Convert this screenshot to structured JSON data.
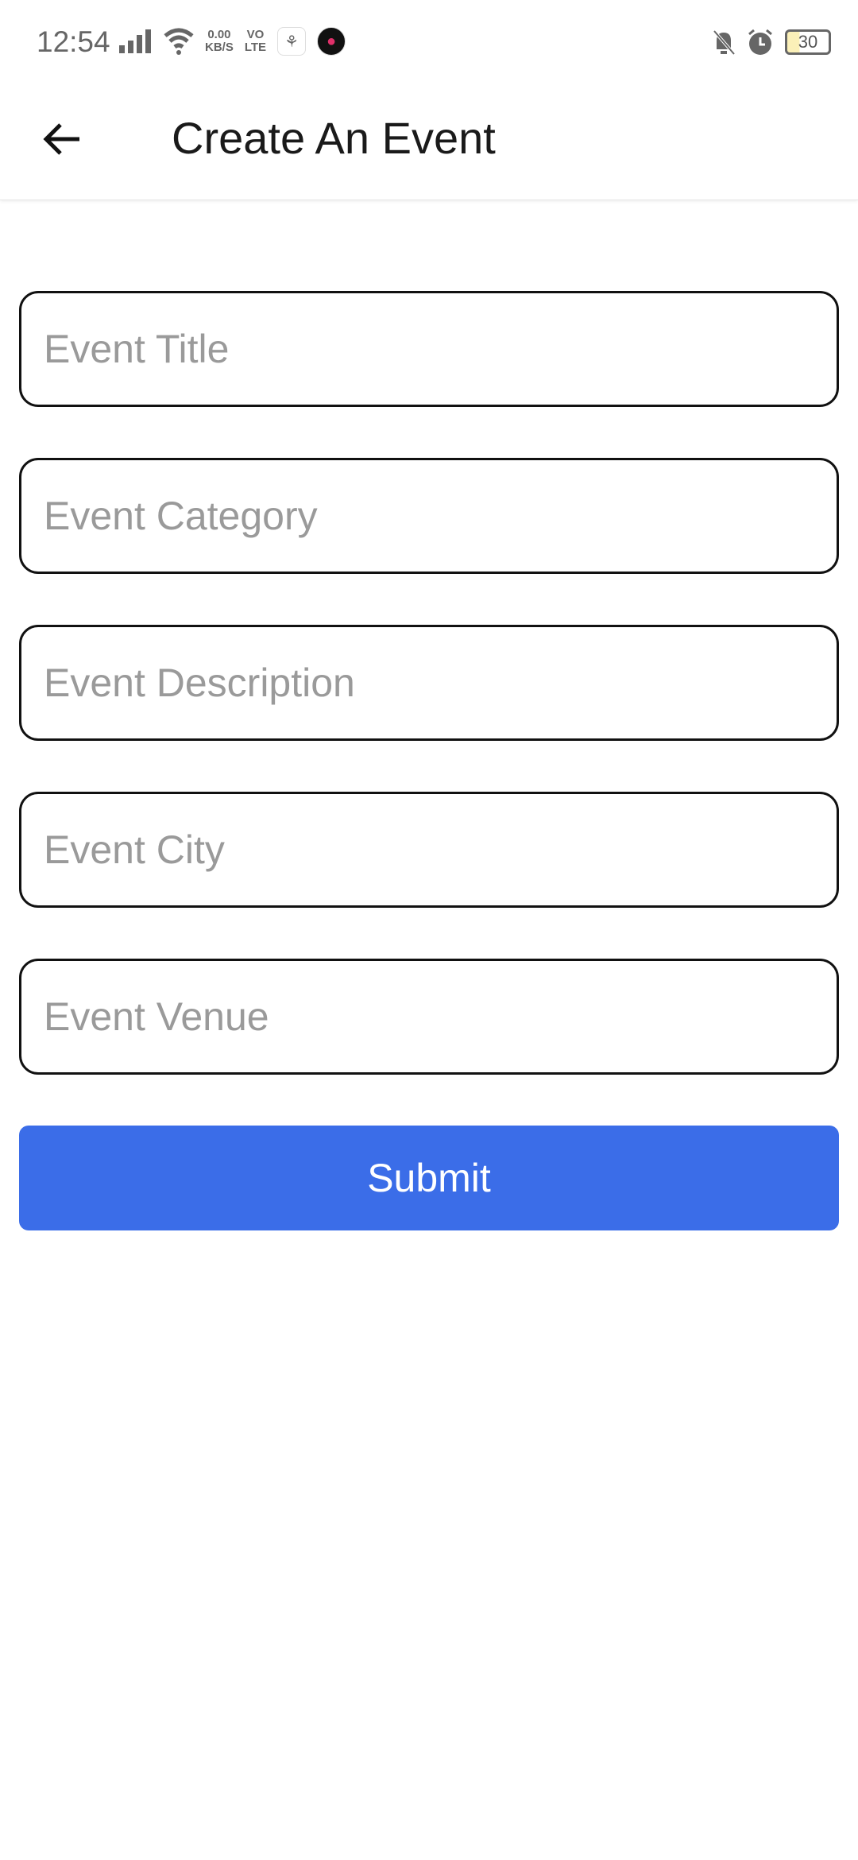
{
  "status_bar": {
    "time": "12:54",
    "net_speed": "0.00",
    "net_unit": "KB/S",
    "volte_top": "VO",
    "volte_bottom": "LTE",
    "battery": "30"
  },
  "header": {
    "title": "Create An Event"
  },
  "form": {
    "fields": [
      {
        "placeholder": "Event Title",
        "value": ""
      },
      {
        "placeholder": "Event Category",
        "value": ""
      },
      {
        "placeholder": "Event Description",
        "value": ""
      },
      {
        "placeholder": "Event City",
        "value": ""
      },
      {
        "placeholder": "Event Venue",
        "value": ""
      }
    ],
    "submit_label": "Submit"
  },
  "colors": {
    "accent": "#3b6de8"
  }
}
